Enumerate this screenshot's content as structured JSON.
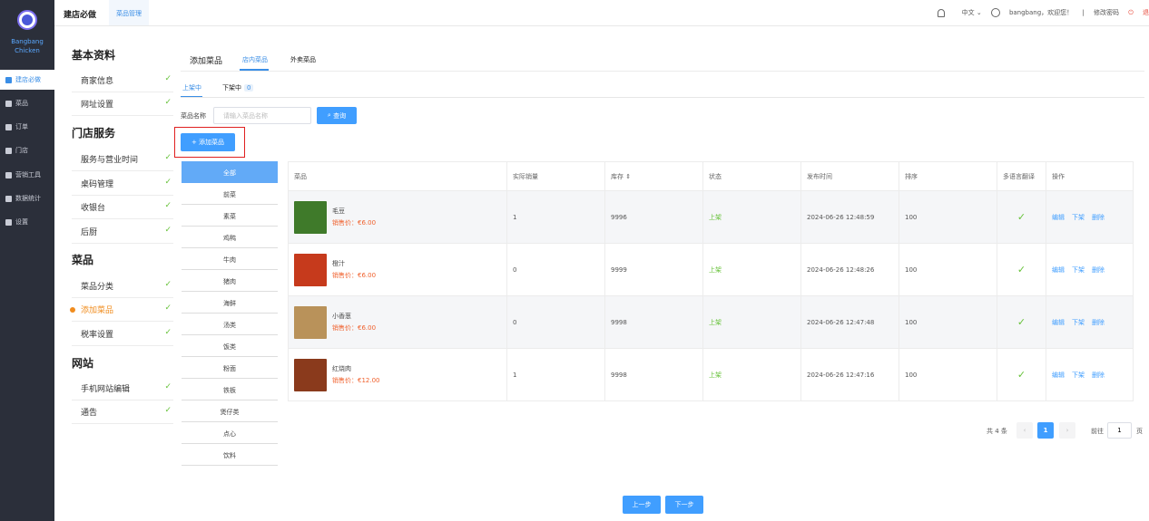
{
  "sidebar": {
    "brand_line1": "Bangbang",
    "brand_line2": "Chicken",
    "nav": [
      {
        "label": "建店必做",
        "icon": "checklist-icon"
      },
      {
        "label": "菜品",
        "icon": "box-icon"
      },
      {
        "label": "订单",
        "icon": "fork-knife-icon"
      },
      {
        "label": "门店",
        "icon": "store-icon"
      },
      {
        "label": "营销工具",
        "icon": "crown-icon"
      },
      {
        "label": "数据统计",
        "icon": "chart-icon"
      },
      {
        "label": "设置",
        "icon": "gear-icon"
      }
    ]
  },
  "topbar": {
    "title": "建店必做",
    "tab": "菜品管理",
    "language": "中文",
    "greeting": "bangbang，欢迎您！",
    "separator": "|",
    "change_password": "修改密码",
    "logout": "退"
  },
  "settings": {
    "sections": [
      {
        "title": "基本资料",
        "items": [
          "商家信息",
          "网址设置"
        ]
      },
      {
        "title": "门店服务",
        "items": [
          "服务与营业时间",
          "桌码管理",
          "收银台",
          "后厨"
        ]
      },
      {
        "title": "菜品",
        "items": [
          "菜品分类",
          "添加菜品",
          "税率设置"
        ]
      },
      {
        "title": "网站",
        "items": [
          "手机网站编辑",
          "通告"
        ]
      }
    ],
    "current": "添加菜品"
  },
  "page_tabs": [
    "添加菜品",
    "店内菜品",
    "外卖菜品"
  ],
  "status_tabs": {
    "on": "上架中",
    "off": "下架中",
    "off_count": "0"
  },
  "filter": {
    "label": "菜品名称",
    "placeholder": "请输入菜品名称",
    "search_button": "查询"
  },
  "add_button": "+ 添加菜品",
  "categories": [
    "全部",
    "前菜",
    "素菜",
    "鸡鸭",
    "牛肉",
    "猪肉",
    "海鲜",
    "汤类",
    "饭类",
    "粉面",
    "铁板",
    "煲仔类",
    "点心",
    "饮料"
  ],
  "table": {
    "headers": [
      "菜品",
      "实际销量",
      "库存 ⇕",
      "状态",
      "发布时间",
      "排序",
      "多语言翻译",
      "操作"
    ],
    "rows": [
      {
        "name": "毛豆",
        "price": "销售价：€6.00",
        "sales": "1",
        "stock": "9996",
        "status": "上架",
        "time": "2024-06-26 12:48:59",
        "sort": "100"
      },
      {
        "name": "橙汁",
        "price": "销售价：€6.00",
        "sales": "0",
        "stock": "9999",
        "status": "上架",
        "time": "2024-06-26 12:48:26",
        "sort": "100"
      },
      {
        "name": "小香葱",
        "price": "销售价：€6.00",
        "sales": "0",
        "stock": "9998",
        "status": "上架",
        "time": "2024-06-26 12:47:48",
        "sort": "100"
      },
      {
        "name": "红烧肉",
        "price": "销售价：€12.00",
        "sales": "1",
        "stock": "9998",
        "status": "上架",
        "time": "2024-06-26 12:47:16",
        "sort": "100"
      }
    ],
    "actions": [
      "编辑",
      "下架",
      "删除"
    ],
    "thumb_colors": [
      "#3f7a2a",
      "#c63a1c",
      "#b9925a",
      "#8a3a1c"
    ]
  },
  "pagination": {
    "total": "共 4 条",
    "current": "1",
    "goto_label": "前往",
    "goto_value": "1",
    "unit": "页"
  },
  "footer": {
    "prev": "上一步",
    "next": "下一步"
  },
  "colors": {
    "accent": "#409eff",
    "sidebar_bg": "#2b2f3a",
    "highlight": "#e02020"
  }
}
